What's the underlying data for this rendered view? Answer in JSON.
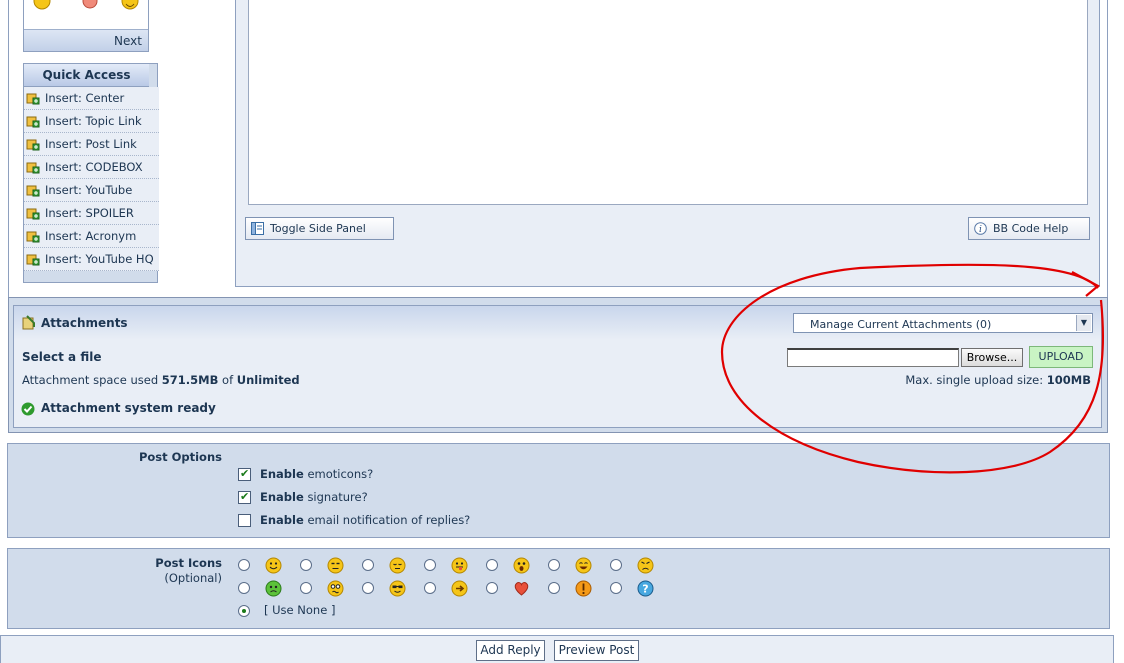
{
  "emoticons_panel": {
    "next_label": "Next"
  },
  "quick_access": {
    "title": "Quick Access",
    "items": [
      "Insert: Center",
      "Insert: Topic Link",
      "Insert: Post Link",
      "Insert: CODEBOX",
      "Insert: YouTube",
      "Insert: SPOILER",
      "Insert: Acronym",
      "Insert: YouTube HQ"
    ]
  },
  "editor": {
    "toggle_label": "Toggle Side Panel",
    "help_label": "BB Code Help"
  },
  "attachments": {
    "title": "Attachments",
    "manage_label": "Manage Current Attachments (0)",
    "select_file_label": "Select a file",
    "space_used_prefix": "Attachment space used",
    "space_used_value": "571.5MB",
    "space_of": "of",
    "space_limit": "Unlimited",
    "browse_label": "Browse...",
    "upload_label": "UPLOAD",
    "max_size_prefix": "Max. single upload size:",
    "max_size_value": "100MB",
    "status": "Attachment system ready"
  },
  "post_options": {
    "label": "Post Options",
    "options": [
      {
        "bold": "Enable",
        "rest": "emoticons?",
        "checked": true
      },
      {
        "bold": "Enable",
        "rest": "signature?",
        "checked": true
      },
      {
        "bold": "Enable",
        "rest": "email notification of replies?",
        "checked": false
      }
    ]
  },
  "post_icons": {
    "label": "Post Icons",
    "sublabel": "(Optional)",
    "use_none": "[ Use None ]",
    "row1": [
      "smile-icon",
      "unsure-icon",
      "sleepy-icon",
      "tongue-icon",
      "shocked-icon",
      "biggrin-icon",
      "angry-icon"
    ],
    "row2": [
      "sick-icon",
      "confused-icon",
      "cool-icon",
      "arrow-icon",
      "heart-icon",
      "exclamation-icon",
      "question-icon"
    ]
  },
  "actions": {
    "add_reply": "Add Reply",
    "preview_post": "Preview Post"
  },
  "colors": {
    "panel_bg": "#d1dceb",
    "inner_bg": "#e9eef6",
    "border": "#8ea0bf",
    "text": "#1d3652",
    "upload_bg": "#c9f4c4",
    "annotation": "#e00000"
  }
}
